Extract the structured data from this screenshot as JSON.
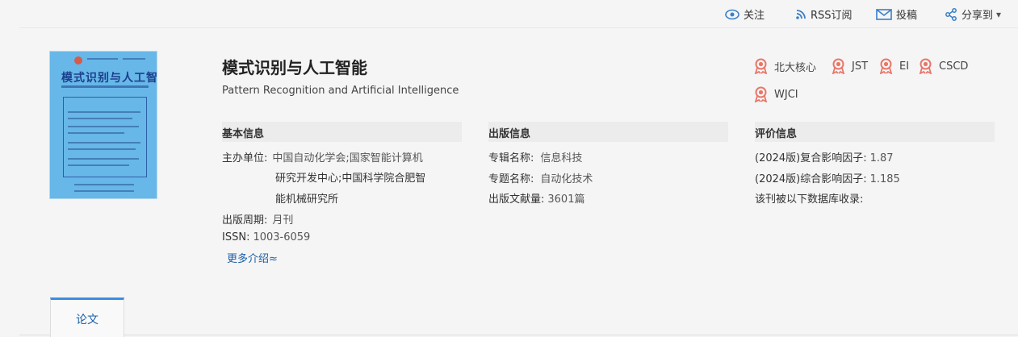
{
  "topbar": {
    "follow": "关注",
    "rss": "RSS订阅",
    "submit": "投稿",
    "share": "分享到",
    "share_caret": "▾"
  },
  "journal": {
    "title": "模式识别与人工智能",
    "english_title": "Pattern Recognition and Artificial Intelligence",
    "cover_title": "模式识别与人工智能"
  },
  "badges": [
    "北大核心",
    "JST",
    "EI",
    "CSCD",
    "WJCI"
  ],
  "basic": {
    "heading": "基本信息",
    "sponsor_label": "主办单位:",
    "sponsor_lines": [
      "中国自动化学会;国家智能计算机",
      "研究开发中心;中国科学院合肥智",
      "能机械研究所"
    ],
    "cycle_label": "出版周期:",
    "cycle_value": "月刊",
    "issn_label": "ISSN:",
    "issn_value": "1003-6059",
    "more": "更多介绍≈"
  },
  "publish": {
    "heading": "出版信息",
    "album_label": "专辑名称:",
    "album_value": "信息科技",
    "topic_label": "专题名称:",
    "topic_value": "自动化技术",
    "count_label": "出版文献量:",
    "count_value": "3601篇"
  },
  "eval": {
    "heading": "评价信息",
    "compound": "(2024版)复合影响因子:",
    "compound_value": "1.87",
    "composite": "(2024版)综合影响因子:",
    "composite_value": "1.185",
    "db_line": "该刊被以下数据库收录:"
  },
  "tabs": {
    "papers": "论文"
  },
  "colors": {
    "accent_blue": "#1a5fa6",
    "badge_red": "#e8776a",
    "tab_border": "#3b8de0"
  }
}
